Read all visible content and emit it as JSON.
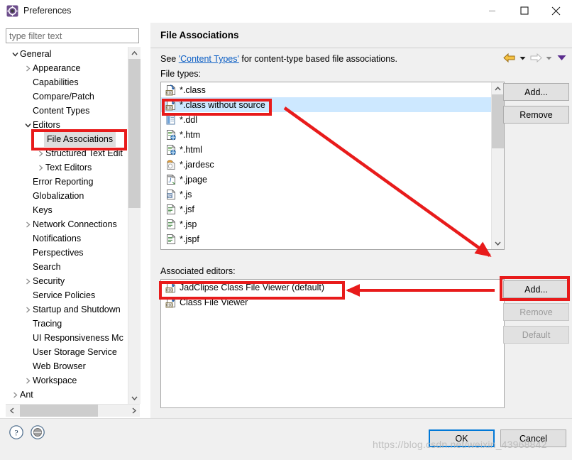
{
  "window": {
    "title": "Preferences",
    "icon": "preferences-gear-icon",
    "minimize_label": "Minimize",
    "maximize_label": "Maximize",
    "close_label": "Close"
  },
  "sidebar": {
    "filter_placeholder": "type filter text",
    "filter_value": "",
    "items": [
      {
        "label": "General",
        "indent": 0,
        "twisty": "expanded",
        "selected": false
      },
      {
        "label": "Appearance",
        "indent": 1,
        "twisty": "collapsed",
        "selected": false
      },
      {
        "label": "Capabilities",
        "indent": 1,
        "twisty": "none",
        "selected": false
      },
      {
        "label": "Compare/Patch",
        "indent": 1,
        "twisty": "none",
        "selected": false
      },
      {
        "label": "Content Types",
        "indent": 1,
        "twisty": "none",
        "selected": false
      },
      {
        "label": "Editors",
        "indent": 1,
        "twisty": "expanded",
        "selected": false
      },
      {
        "label": "File Associations",
        "indent": 2,
        "twisty": "none",
        "selected": true
      },
      {
        "label": "Structured Text Edit",
        "indent": 2,
        "twisty": "collapsed",
        "selected": false
      },
      {
        "label": "Text Editors",
        "indent": 2,
        "twisty": "collapsed",
        "selected": false
      },
      {
        "label": "Error Reporting",
        "indent": 1,
        "twisty": "none",
        "selected": false
      },
      {
        "label": "Globalization",
        "indent": 1,
        "twisty": "none",
        "selected": false
      },
      {
        "label": "Keys",
        "indent": 1,
        "twisty": "none",
        "selected": false
      },
      {
        "label": "Network Connections",
        "indent": 1,
        "twisty": "collapsed",
        "selected": false
      },
      {
        "label": "Notifications",
        "indent": 1,
        "twisty": "none",
        "selected": false
      },
      {
        "label": "Perspectives",
        "indent": 1,
        "twisty": "none",
        "selected": false
      },
      {
        "label": "Search",
        "indent": 1,
        "twisty": "none",
        "selected": false
      },
      {
        "label": "Security",
        "indent": 1,
        "twisty": "collapsed",
        "selected": false
      },
      {
        "label": "Service Policies",
        "indent": 1,
        "twisty": "none",
        "selected": false
      },
      {
        "label": "Startup and Shutdown",
        "indent": 1,
        "twisty": "collapsed",
        "selected": false
      },
      {
        "label": "Tracing",
        "indent": 1,
        "twisty": "none",
        "selected": false
      },
      {
        "label": "UI Responsiveness Mc",
        "indent": 1,
        "twisty": "none",
        "selected": false
      },
      {
        "label": "User Storage Service",
        "indent": 1,
        "twisty": "none",
        "selected": false
      },
      {
        "label": "Web Browser",
        "indent": 1,
        "twisty": "none",
        "selected": false
      },
      {
        "label": "Workspace",
        "indent": 1,
        "twisty": "collapsed",
        "selected": false
      },
      {
        "label": "Ant",
        "indent": 0,
        "twisty": "collapsed",
        "selected": false
      }
    ]
  },
  "main": {
    "title": "File Associations",
    "description_prefix": "See ",
    "description_link": "'Content Types'",
    "description_suffix": " for content-type based file associations.",
    "file_types_label": "File types:",
    "associated_editors_label": "Associated editors:",
    "file_types": [
      {
        "name": "*.class",
        "icon": "class-file-icon",
        "selected": false
      },
      {
        "name": "*.class without source",
        "icon": "class-file-icon",
        "selected": true
      },
      {
        "name": "*.ddl",
        "icon": "ddl-file-icon",
        "selected": false
      },
      {
        "name": "*.htm",
        "icon": "html-file-icon",
        "selected": false
      },
      {
        "name": "*.html",
        "icon": "html-file-icon",
        "selected": false
      },
      {
        "name": "*.jardesc",
        "icon": "jardesc-file-icon",
        "selected": false
      },
      {
        "name": "*.jpage",
        "icon": "jpage-file-icon",
        "selected": false
      },
      {
        "name": "*.js",
        "icon": "js-file-icon",
        "selected": false
      },
      {
        "name": "*.jsf",
        "icon": "jsf-file-icon",
        "selected": false
      },
      {
        "name": "*.jsp",
        "icon": "jsp-file-icon",
        "selected": false
      },
      {
        "name": "*.jspf",
        "icon": "jspf-file-icon",
        "selected": false
      }
    ],
    "associated_editors": [
      {
        "name": "JadClipse Class File Viewer (default)",
        "icon": "class-file-icon"
      },
      {
        "name": "Class File Viewer",
        "icon": "class-file-icon"
      }
    ],
    "buttons": {
      "file_types_add": "Add...",
      "file_types_remove": "Remove",
      "editors_add": "Add...",
      "editors_remove": "Remove",
      "editors_default": "Default"
    }
  },
  "footer": {
    "ok_label": "OK",
    "cancel_label": "Cancel",
    "help_icon": "help-question-icon",
    "apply_icon": "apply-circle-icon",
    "watermark": "https://blog.csdn.net/weixin_43968842"
  },
  "nav": {
    "back_icon": "back-arrow-icon",
    "back_dropdown_icon": "chevron-down-icon",
    "forward_icon": "forward-arrow-icon",
    "forward_dropdown_icon": "chevron-down-icon",
    "menu_icon": "chevron-down-filled-icon"
  },
  "annotations": {
    "accent_color": "#e81b1b",
    "boxes": [
      "file-associations-tree-item",
      "class-without-source-row",
      "jadclipse-editor-row",
      "editors-add-button"
    ],
    "arrows": [
      "diagonal-arrow-to-list-bottom",
      "horizontal-arrow-to-add-button"
    ]
  }
}
